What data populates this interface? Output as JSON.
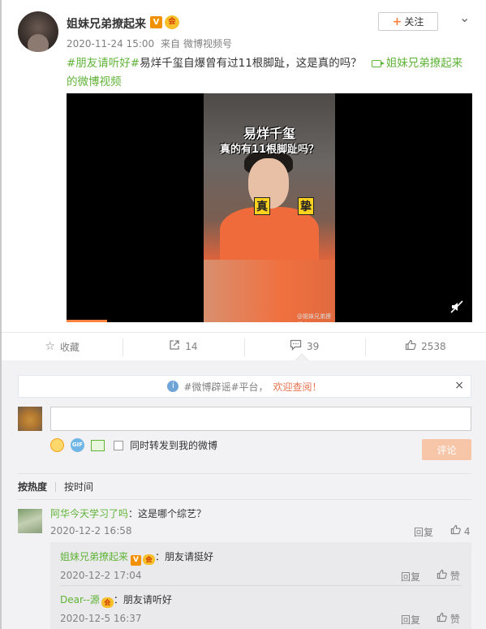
{
  "post": {
    "author": "姐妹兄弟撩起来",
    "vip_badge": "V",
    "crown_badge": "会",
    "time": "2020-11-24 15:00",
    "source_prefix": "来自",
    "source": "微博视频号",
    "follow_label": "关注",
    "follow_plus": "+",
    "tag1": "#朋友请听好#",
    "text": "易烊千玺自爆曾有过11根脚趾，这是真的吗？",
    "video_link_line1": "姐妹兄弟撩起来",
    "video_link_line2": "的微博视频"
  },
  "video": {
    "caption_line1": "易烊千玺",
    "caption_line2": "真的有11根脚趾吗？",
    "sticker_left": "真",
    "sticker_right": "挚",
    "watermark": "@姐妹兄弟撩起来",
    "progress": 0.1
  },
  "actions": {
    "favorite_label": "收藏",
    "repost_count": "14",
    "comment_count": "39",
    "like_count": "2538"
  },
  "comment_box": {
    "notice_tag": "#微博辟谣#平台，",
    "notice_highlight": "欢迎查阅！",
    "notice_close": "×",
    "input_value": "",
    "gif_label": "GIF",
    "repost_checkbox_label": "同时转发到我的微博",
    "submit_label": "评论"
  },
  "sort": {
    "hot": "按热度",
    "time": "按时间"
  },
  "comments": [
    {
      "user": "阿华今天学习了吗",
      "text": "：这是哪个综艺？",
      "time": "2020-12-2 16:58",
      "reply_label": "回复",
      "likes": "4",
      "replies": [
        {
          "user": "姐妹兄弟撩起来",
          "vip_badge": "V",
          "crown_badge": "会",
          "text": "：朋友请挺好",
          "time": "2020-12-2 17:04",
          "reply_label": "回复",
          "like_label": "赞"
        },
        {
          "user": "Dear--源",
          "crown_badge": "会",
          "text": "：朋友请听好",
          "time": "2020-12-5 16:37",
          "reply_label": "回复",
          "like_label": "赞"
        }
      ]
    }
  ],
  "icons": {
    "favorite": "star-icon",
    "repost": "share-icon",
    "comment": "comment-icon",
    "like": "thumb-up-icon",
    "mute": "mute-icon",
    "info": "info-icon"
  },
  "colors": {
    "accent_green": "#5fb336",
    "accent_orange": "#ff8140",
    "submit_disabled": "#f7c5a8"
  }
}
